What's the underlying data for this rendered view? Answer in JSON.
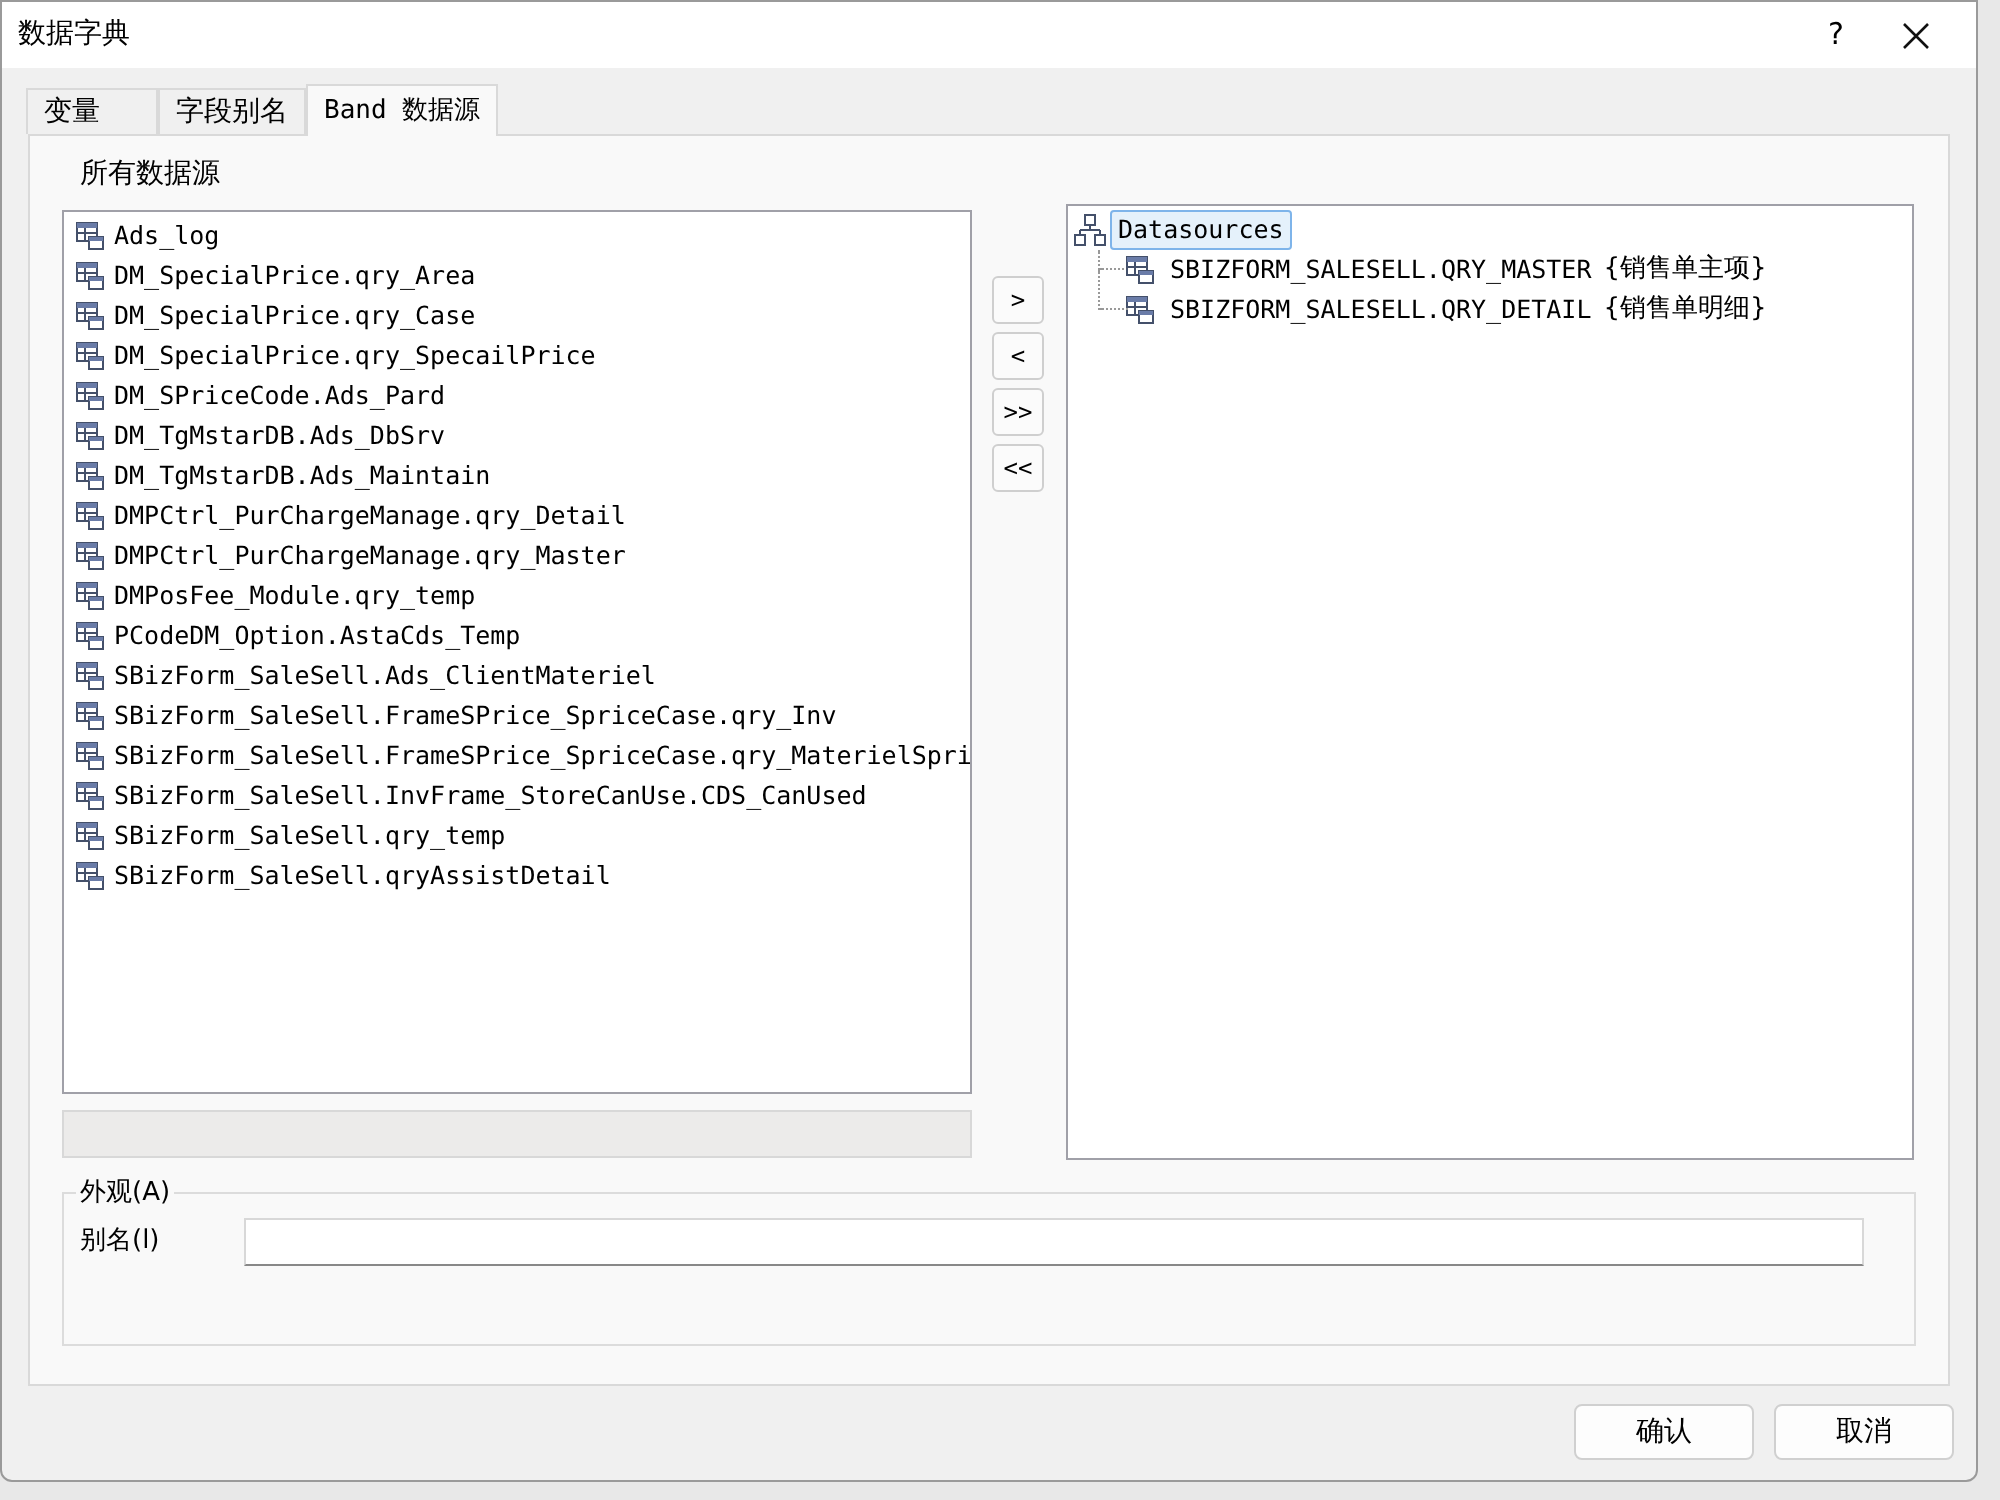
{
  "window": {
    "title": "数据字典",
    "help": "?"
  },
  "tabs": [
    {
      "label": "变量",
      "selected": false
    },
    {
      "label": "字段别名",
      "selected": false
    },
    {
      "label": "Band 数据源",
      "selected": true
    }
  ],
  "all_sources": {
    "label": "所有数据源",
    "items": [
      {
        "label": "Ads_log"
      },
      {
        "label": "DM_SpecialPrice.qry_Area"
      },
      {
        "label": "DM_SpecialPrice.qry_Case"
      },
      {
        "label": "DM_SpecialPrice.qry_SpecailPrice"
      },
      {
        "label": "DM_SPriceCode.Ads_Pard"
      },
      {
        "label": "DM_TgMstarDB.Ads_DbSrv"
      },
      {
        "label": "DM_TgMstarDB.Ads_Maintain"
      },
      {
        "label": "DMPCtrl_PurChargeManage.qry_Detail"
      },
      {
        "label": "DMPCtrl_PurChargeManage.qry_Master"
      },
      {
        "label": "DMPosFee_Module.qry_temp"
      },
      {
        "label": "PCodeDM_Option.AstaCds_Temp"
      },
      {
        "label": "SBizForm_SaleSell.Ads_ClientMateriel"
      },
      {
        "label": "SBizForm_SaleSell.FrameSPrice_SpriceCase.qry_Inv"
      },
      {
        "label": "SBizForm_SaleSell.FrameSPrice_SpriceCase.qry_MaterielSpri"
      },
      {
        "label": "SBizForm_SaleSell.InvFrame_StoreCanUse.CDS_CanUsed"
      },
      {
        "label": "SBizForm_SaleSell.qry_temp"
      },
      {
        "label": "SBizForm_SaleSell.qryAssistDetail"
      }
    ]
  },
  "move_buttons": [
    ">",
    "<",
    ">>",
    "<<"
  ],
  "tree": {
    "label": "Datasources",
    "selected": true,
    "expanded": true,
    "children": [
      {
        "label": "SBIZFORM_SALESELL.QRY_MASTER",
        "alias": "{销售单主项}"
      },
      {
        "label": "SBIZFORM_SALESELL.QRY_DETAIL",
        "alias": "{销售单明细}"
      }
    ]
  },
  "appearance": {
    "title": "外观(A)",
    "alias_label": "别名(l)"
  },
  "buttons": [
    "确认",
    "取消"
  ]
}
